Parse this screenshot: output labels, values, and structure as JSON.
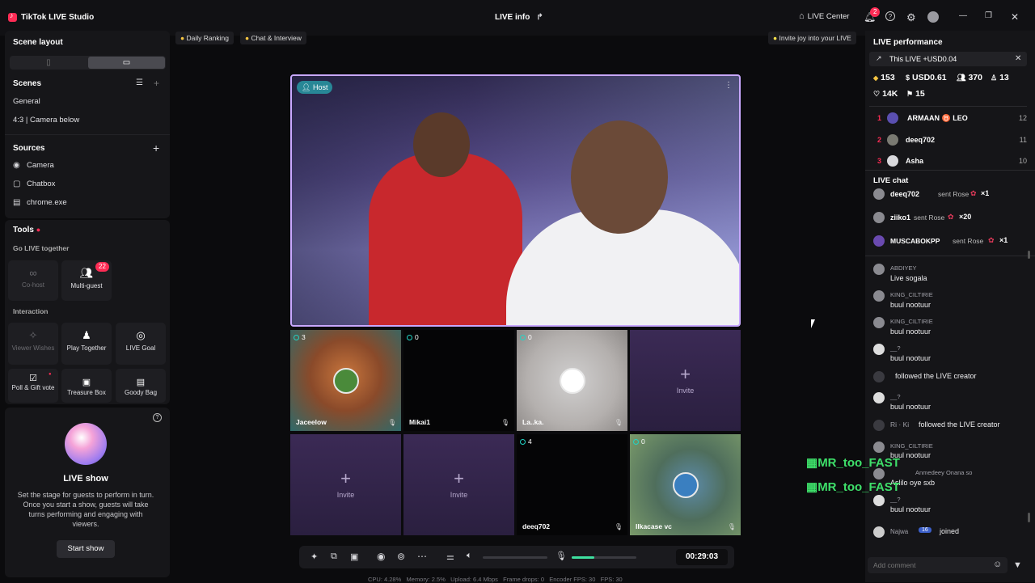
{
  "app": {
    "title": "TikTok LIVE Studio",
    "live_info": "LIVE info",
    "live_center": "LIVE Center",
    "notif_count": "2"
  },
  "left": {
    "scene_layout": "Scene layout",
    "scenes": {
      "title": "Scenes",
      "items": [
        "General",
        "4:3 | Camera below"
      ]
    },
    "sources": {
      "title": "Sources",
      "items": [
        "Camera",
        "Chatbox",
        "chrome.exe"
      ]
    },
    "tools": {
      "title": "Tools",
      "go_live_together": "Go LIVE together",
      "cohost": "Co-host",
      "multiguest": "Multi-guest",
      "multiguest_badge": "22",
      "interaction": "Interaction",
      "viewer_wishes": "Viewer Wishes",
      "play_together": "Play Together",
      "live_goal": "LIVE Goal",
      "poll": "Poll & Gift vote",
      "treasure": "Treasure Box",
      "goody": "Goody Bag"
    },
    "live_show": {
      "title": "LIVE show",
      "desc": "Set the stage for guests to perform in turn. Once you start a show, guests will take turns performing and engaging with viewers.",
      "button": "Start show"
    }
  },
  "stage": {
    "tabs": [
      "Daily Ranking",
      "Chat & Interview"
    ],
    "invite_banner": "Invite joy into your LIVE",
    "host_label": "Host",
    "guests": [
      {
        "num": "3",
        "name": "Jaceelow"
      },
      {
        "num": "0",
        "name": "Mikai1"
      },
      {
        "num": "0",
        "name": "La..ka."
      },
      {
        "num": "",
        "name": ""
      },
      {
        "num": "",
        "name": ""
      },
      {
        "num": "",
        "name": ""
      },
      {
        "num": "4",
        "name": "deeq702"
      },
      {
        "num": "0",
        "name": "Ilkacase vc"
      }
    ],
    "invite": "Invite",
    "timer": "00:29:03",
    "volume_level": 0.35,
    "status": "CPU: 4.28%   Memory: 2.5%   Upload: 6.4 Mbps   Frame drops: 0   Encoder FPS: 30   FPS: 30"
  },
  "right": {
    "performance_title": "LIVE performance",
    "this_live": "This LIVE +USD0.04",
    "stats": {
      "diamonds": "153",
      "usd": "USD0.61",
      "viewers": "370",
      "new_followers": "13",
      "likes": "14K",
      "gifters": "15"
    },
    "ranking": [
      {
        "rank": "1",
        "name": "ARMAAN ♉ LEO",
        "score": "12"
      },
      {
        "rank": "2",
        "name": "deeq702",
        "score": "11"
      },
      {
        "rank": "3",
        "name": "Asha",
        "score": "10"
      }
    ],
    "chat_title": "LIVE chat",
    "gifts": [
      {
        "user": "deeq702",
        "action": "sent Rose",
        "count": "×1"
      },
      {
        "user": "ziiko1",
        "action": "sent Rose",
        "count": "×20"
      },
      {
        "user": "MUSCABOKPP",
        "action": "sent Rose",
        "count": "×1"
      }
    ],
    "messages": [
      {
        "user": "ABDIYEY",
        "text": "Live sogala"
      },
      {
        "user": "KING_CILTIRIE",
        "text": "buul nootuur"
      },
      {
        "user": "KING_CILTIRIE",
        "text": "buul nootuur"
      },
      {
        "user": "__?",
        "text": "buul nootuur"
      },
      {
        "user": "",
        "text": "followed the LIVE creator"
      },
      {
        "user": "__?",
        "text": "buul nootuur"
      },
      {
        "user": "Ri · Ki",
        "text": "followed the LIVE creator"
      },
      {
        "user": "KING_CILTIRIE",
        "text": "buul nootuur"
      },
      {
        "user": "Anmedeey Onana so",
        "text": "Aslilo oye sxb"
      },
      {
        "user": "__?",
        "text": "buul nootuur"
      },
      {
        "user": "Najwa",
        "text": "joined"
      }
    ],
    "overlay_name": "MR_too_FAST",
    "add_comment": "Add comment"
  }
}
